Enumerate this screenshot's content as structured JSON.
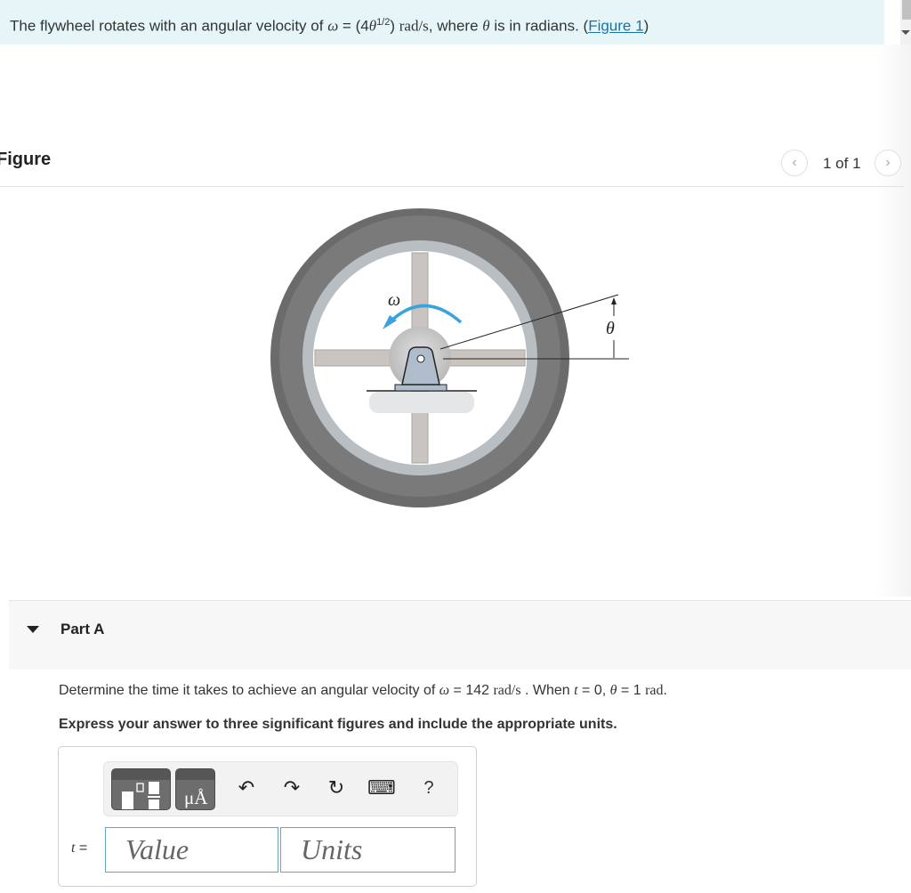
{
  "intro": {
    "text_before": "The flywheel rotates with an angular velocity of ",
    "omega": "ω",
    "equals": " = (4",
    "theta": "θ",
    "exponent": "1/2",
    "close": ") ",
    "unit": "rad/s",
    "text_after": ", where ",
    "theta2": "θ",
    "text_end": " is in radians. (",
    "figure_link": "Figure 1",
    "close_paren": ")"
  },
  "figure": {
    "title": "Figure",
    "pager": {
      "prev_icon": "‹",
      "count": "1 of 1",
      "next_icon": "›"
    },
    "labels": {
      "omega": "ω",
      "theta": "θ"
    },
    "colors": {
      "tire": "#6b6b6b",
      "rim": "#b9bec2",
      "spokes": "#c9c4bf",
      "arrow": "#3aa3db",
      "bracket": "#aebccb"
    }
  },
  "part": {
    "title": "Part A",
    "question": {
      "pre": "Determine the time it takes to achieve an angular velocity of ",
      "omega": "ω",
      "eq": " = 142 ",
      "unit": "rad/s",
      "mid": " . When ",
      "t": "t",
      "eq2": " = 0, ",
      "theta": "θ",
      "eq3": " = 1 ",
      "unit2": "rad",
      "end": "."
    },
    "instruction": "Express your answer to three significant figures and include the appropriate units."
  },
  "answer": {
    "variable_label": "t",
    "equals": " =",
    "value_placeholder": "Value",
    "units_placeholder": "Units",
    "toolbar": {
      "templates_icon": "templates-icon",
      "units_label": "μÅ",
      "undo_icon": "↶",
      "redo_icon": "↷",
      "reset_icon": "↻",
      "keyboard_icon": "⌨",
      "help_label": "?"
    }
  }
}
